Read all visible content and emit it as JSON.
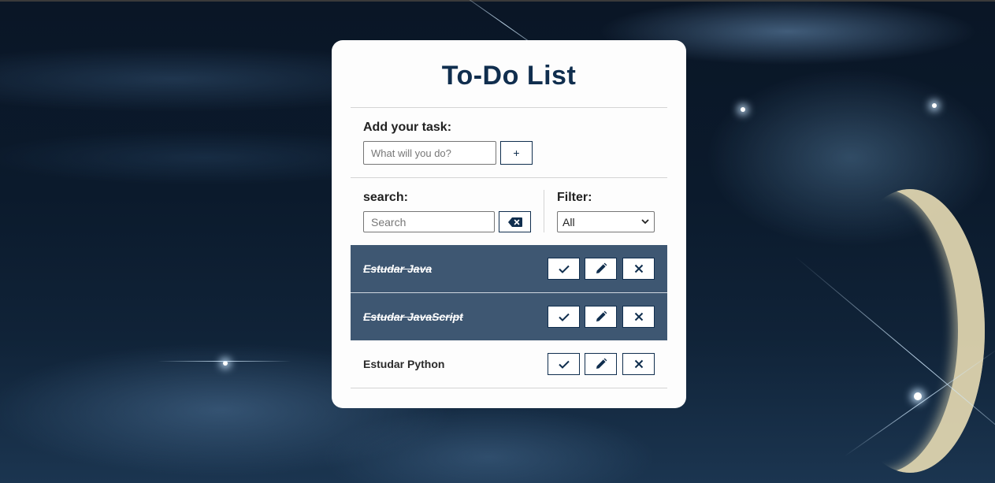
{
  "app": {
    "title": "To-Do List"
  },
  "add": {
    "label": "Add your task:",
    "input": {
      "placeholder": "What will you do?",
      "value": ""
    },
    "add_button_label": "+"
  },
  "search": {
    "label": "search:",
    "input": {
      "placeholder": "Search",
      "value": ""
    },
    "clear_icon": "backspace-icon"
  },
  "filter": {
    "label": "Filter:",
    "selected": "All"
  },
  "todos": [
    {
      "text": "Estudar Java",
      "done": true
    },
    {
      "text": "Estudar JavaScript",
      "done": true
    },
    {
      "text": "Estudar Python",
      "done": false
    }
  ],
  "todo_actions": {
    "finish_icon": "check-icon",
    "edit_icon": "pencil-icon",
    "remove_icon": "close-icon"
  },
  "colors": {
    "primary": "#102e4e",
    "done_row": "#3e5772",
    "card": "#fdfdfd"
  }
}
